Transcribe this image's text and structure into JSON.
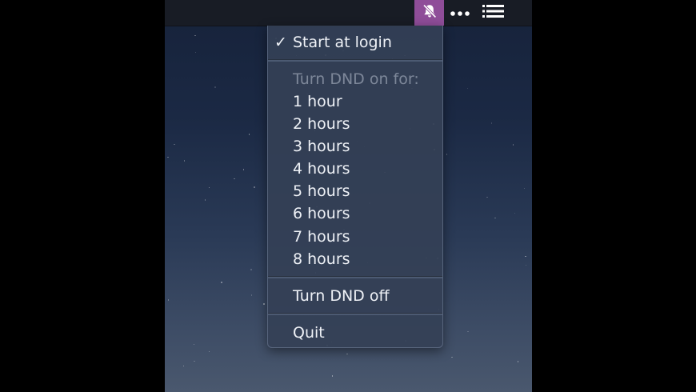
{
  "menubar": {
    "icons": [
      {
        "name": "bell-slash-icon",
        "glyph": "bell with slash",
        "active": true,
        "highlight_color": "#8f4d99"
      },
      {
        "name": "more-icon",
        "glyph": "•••"
      },
      {
        "name": "list-icon",
        "glyph": "bulleted list"
      }
    ]
  },
  "menu": {
    "start_at_login": {
      "label": "Start at login",
      "checked": true,
      "check_glyph": "✓"
    },
    "dnd_header": "Turn DND on for:",
    "durations": [
      "1 hour",
      "2 hours",
      "3 hours",
      "4 hours",
      "5 hours",
      "6 hours",
      "7 hours",
      "8 hours"
    ],
    "turn_off": "Turn DND off",
    "quit": "Quit"
  },
  "colors": {
    "menu_background": "#344056",
    "menubar_background": "#181c25",
    "desktop_top": "#16223a",
    "desktop_bottom": "#4a586e",
    "disabled_text": "#7d8799",
    "text": "#eef1f6"
  }
}
